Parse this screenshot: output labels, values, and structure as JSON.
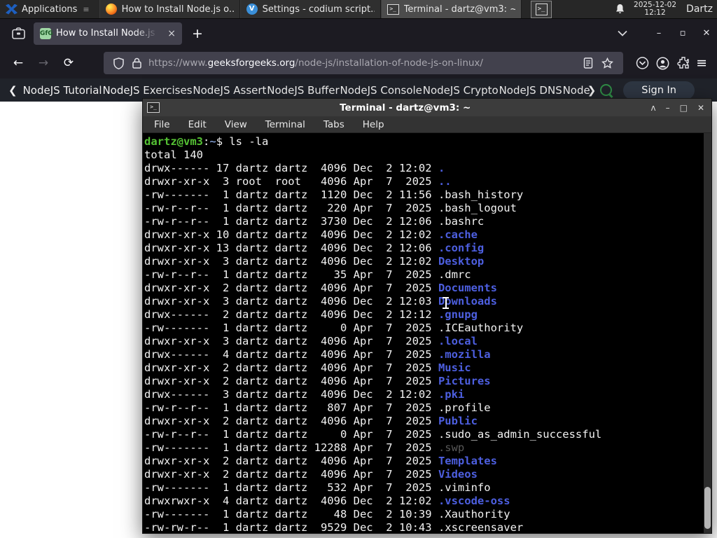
{
  "panel": {
    "applications_label": "Applications",
    "windows": [
      {
        "title": "How to Install Node.js o...",
        "icon": "firefox"
      },
      {
        "title": "Settings - codium script...",
        "icon": "vscodium"
      },
      {
        "title": "Terminal - dartz@vm3: ~",
        "icon": "terminal"
      }
    ],
    "clock": {
      "date": "2025-12-02",
      "time": "12:12"
    },
    "user": "Dartz"
  },
  "browser": {
    "tab_title": "How to Install Node.js on",
    "close_tab": "×",
    "new_tab": "+",
    "window_controls": {
      "minimize": "–",
      "maximize": "▫",
      "close": "✕"
    },
    "url": {
      "prefix": "https://www.",
      "host": "geeksforgeeks.org",
      "path": "/node-js/installation-of-node-js-on-linux/"
    }
  },
  "gfg_nav": {
    "back_chevron": "❮",
    "next_chevron": "❯",
    "items": [
      "NodeJS Tutorial",
      "NodeJS Exercises",
      "NodeJS Assert",
      "NodeJS Buffer",
      "NodeJS Console",
      "NodeJS Crypto",
      "NodeJS DNS",
      "Node"
    ],
    "sign_in": "Sign In"
  },
  "terminal": {
    "title": "Terminal - dartz@vm3: ~",
    "menu": [
      "File",
      "Edit",
      "View",
      "Terminal",
      "Tabs",
      "Help"
    ],
    "prompt": {
      "user_host": "dartz@vm3",
      "sep": ":",
      "path": "~",
      "rest": "$ ls -la"
    },
    "total_line": "total 140",
    "rows": [
      {
        "meta": "drwx------ 17 dartz dartz  4096 Dec  2 12:02 ",
        "name": ".",
        "type": "dir"
      },
      {
        "meta": "drwxr-xr-x  3 root  root   4096 Apr  7  2025 ",
        "name": "..",
        "type": "dir"
      },
      {
        "meta": "-rw-------  1 dartz dartz  1120 Dec  2 11:56 ",
        "name": ".bash_history",
        "type": "file"
      },
      {
        "meta": "-rw-r--r--  1 dartz dartz   220 Apr  7  2025 ",
        "name": ".bash_logout",
        "type": "file"
      },
      {
        "meta": "-rw-r--r--  1 dartz dartz  3730 Dec  2 12:06 ",
        "name": ".bashrc",
        "type": "file"
      },
      {
        "meta": "drwxr-xr-x 10 dartz dartz  4096 Dec  2 12:02 ",
        "name": ".cache",
        "type": "dir"
      },
      {
        "meta": "drwxr-xr-x 13 dartz dartz  4096 Dec  2 12:06 ",
        "name": ".config",
        "type": "dir"
      },
      {
        "meta": "drwxr-xr-x  3 dartz dartz  4096 Dec  2 12:02 ",
        "name": "Desktop",
        "type": "dir"
      },
      {
        "meta": "-rw-r--r--  1 dartz dartz    35 Apr  7  2025 ",
        "name": ".dmrc",
        "type": "file"
      },
      {
        "meta": "drwxr-xr-x  2 dartz dartz  4096 Apr  7  2025 ",
        "name": "Documents",
        "type": "dir"
      },
      {
        "meta": "drwxr-xr-x  3 dartz dartz  4096 Dec  2 12:03 ",
        "name": "Downloads",
        "type": "dir"
      },
      {
        "meta": "drwx------  2 dartz dartz  4096 Dec  2 12:12 ",
        "name": ".gnupg",
        "type": "dir"
      },
      {
        "meta": "-rw-------  1 dartz dartz     0 Apr  7  2025 ",
        "name": ".ICEauthority",
        "type": "file"
      },
      {
        "meta": "drwxr-xr-x  3 dartz dartz  4096 Apr  7  2025 ",
        "name": ".local",
        "type": "dir"
      },
      {
        "meta": "drwx------  4 dartz dartz  4096 Apr  7  2025 ",
        "name": ".mozilla",
        "type": "dir"
      },
      {
        "meta": "drwxr-xr-x  2 dartz dartz  4096 Apr  7  2025 ",
        "name": "Music",
        "type": "dir"
      },
      {
        "meta": "drwxr-xr-x  2 dartz dartz  4096 Apr  7  2025 ",
        "name": "Pictures",
        "type": "dir"
      },
      {
        "meta": "drwx------  3 dartz dartz  4096 Dec  2 12:02 ",
        "name": ".pki",
        "type": "dir"
      },
      {
        "meta": "-rw-r--r--  1 dartz dartz   807 Apr  7  2025 ",
        "name": ".profile",
        "type": "file"
      },
      {
        "meta": "drwxr-xr-x  2 dartz dartz  4096 Apr  7  2025 ",
        "name": "Public",
        "type": "dir"
      },
      {
        "meta": "-rw-r--r--  1 dartz dartz     0 Apr  7  2025 ",
        "name": ".sudo_as_admin_successful",
        "type": "file"
      },
      {
        "meta": "-rw-------  1 dartz dartz 12288 Apr  7  2025 ",
        "name": ".swp",
        "type": "dim"
      },
      {
        "meta": "drwxr-xr-x  2 dartz dartz  4096 Apr  7  2025 ",
        "name": "Templates",
        "type": "dir"
      },
      {
        "meta": "drwxr-xr-x  2 dartz dartz  4096 Apr  7  2025 ",
        "name": "Videos",
        "type": "dir"
      },
      {
        "meta": "-rw-------  1 dartz dartz   532 Apr  7  2025 ",
        "name": ".viminfo",
        "type": "file"
      },
      {
        "meta": "drwxrwxr-x  4 dartz dartz  4096 Dec  2 12:02 ",
        "name": ".vscode-oss",
        "type": "dir"
      },
      {
        "meta": "-rw-------  1 dartz dartz    48 Dec  2 10:39 ",
        "name": ".Xauthority",
        "type": "file"
      },
      {
        "meta": "-rw-rw-r--  1 dartz dartz  9529 Dec  2 10:43 ",
        "name": ".xscreensaver",
        "type": "file"
      }
    ],
    "window_controls": {
      "shade": "ᴧ",
      "minimize": "–",
      "maximize": "□",
      "close": "✕"
    }
  },
  "colors": {
    "prompt_green": "#55c234",
    "dir_blue": "#4d5fe0",
    "dim_gray": "#585858",
    "gfg_green": "#2f8d46",
    "panel_bg": "#272727",
    "firefox_chrome": "#1c1b22",
    "tab_active": "#42414d",
    "terminal_bg": "#000000"
  }
}
